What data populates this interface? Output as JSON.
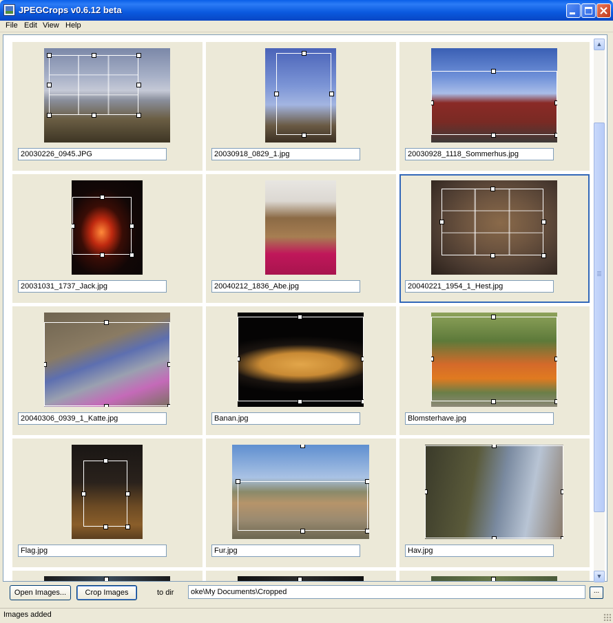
{
  "window": {
    "title": "JPEGCrops v0.6.12 beta"
  },
  "menu": {
    "file": "File",
    "edit": "Edit",
    "view": "View",
    "help": "Help"
  },
  "images": [
    {
      "name": "20030226_0945.JPG"
    },
    {
      "name": "20030918_0829_1.jpg"
    },
    {
      "name": "20030928_1118_Sommerhus.jpg"
    },
    {
      "name": "20031031_1737_Jack.jpg"
    },
    {
      "name": "20040212_1836_Abe.jpg"
    },
    {
      "name": "20040221_1954_1_Hest.jpg"
    },
    {
      "name": "20040306_0939_1_Katte.jpg"
    },
    {
      "name": "Banan.jpg"
    },
    {
      "name": "Blomsterhave.jpg"
    },
    {
      "name": "Flag.jpg"
    },
    {
      "name": "Fur.jpg"
    },
    {
      "name": "Hav.jpg"
    }
  ],
  "bottom": {
    "open_label": "Open Images...",
    "crop_label": "Crop Images",
    "to_dir_label": "to dir",
    "dir_value": "oke\\My Documents\\Cropped",
    "browse_label": "..."
  },
  "status": {
    "text": "Images added"
  },
  "icons": {
    "scroll_up": "▲",
    "scroll_down": "▼"
  },
  "colors": {
    "titlebar": "#0a59de",
    "selection": "#3167b8",
    "cell_bg": "#ece9d8"
  }
}
